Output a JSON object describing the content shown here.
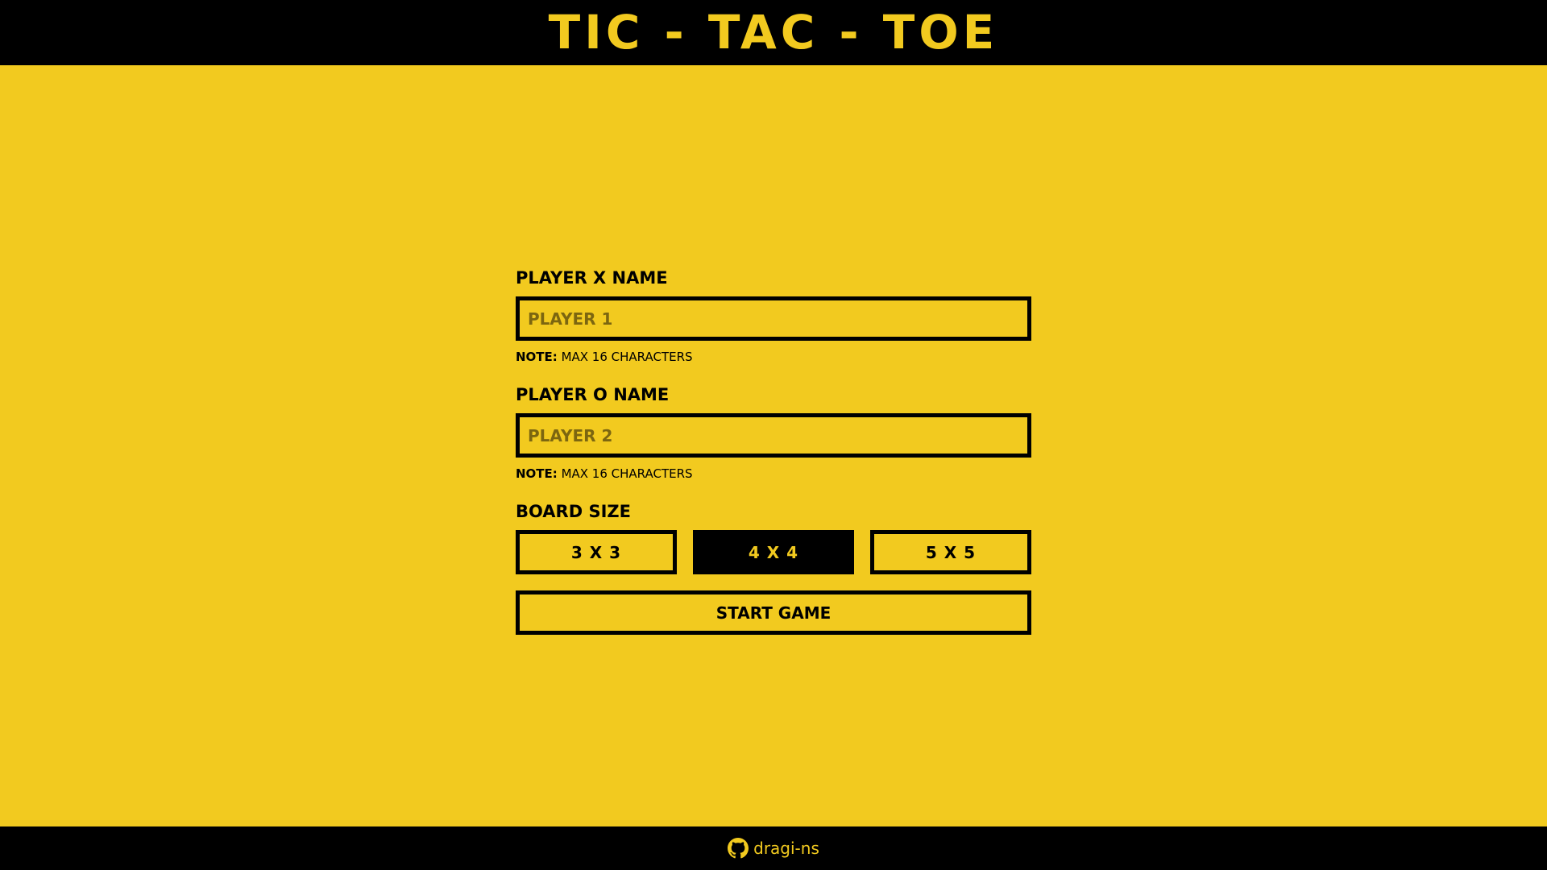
{
  "header": {
    "title": "TIC - TAC - TOE"
  },
  "form": {
    "player_x": {
      "label": "PLAYER X NAME",
      "value": "",
      "placeholder": "PLAYER 1",
      "note_prefix": "NOTE:",
      "note_text": " MAX 16 CHARACTERS"
    },
    "player_o": {
      "label": "PLAYER O NAME",
      "value": "",
      "placeholder": "PLAYER 2",
      "note_prefix": "NOTE:",
      "note_text": " MAX 16 CHARACTERS"
    },
    "board_size": {
      "label": "BOARD SIZE",
      "options": [
        "3 X 3",
        "4 X 4",
        "5 X 5"
      ],
      "selected": "4 X 4"
    },
    "start_label": "START GAME"
  },
  "footer": {
    "icon": "github-icon",
    "link_text": "dragi-ns"
  },
  "colors": {
    "background": "#f2ca1f",
    "bars": "#000000",
    "accent": "#f2ca1f",
    "placeholder": "#7c6610"
  }
}
